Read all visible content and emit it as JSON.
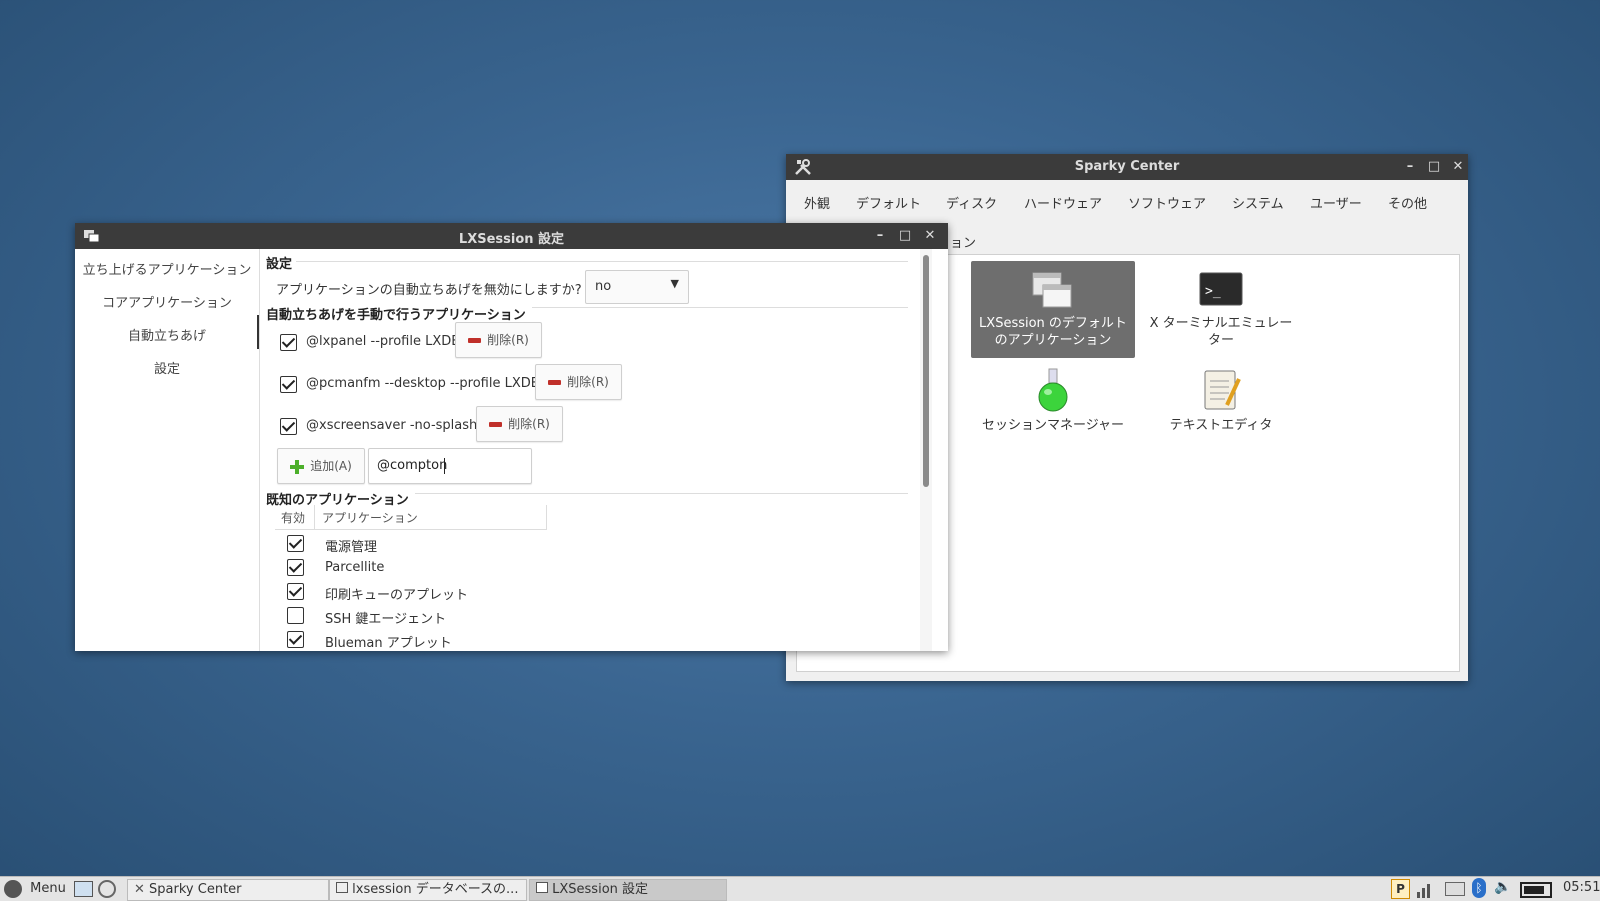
{
  "sparky": {
    "title": "Sparky Center",
    "tabs": [
      "外観",
      "デフォルト",
      "ディスク",
      "ハードウェア",
      "ソフトウェア",
      "システム",
      "ユーザー",
      "その他"
    ],
    "partial_text_1": "ョン",
    "partial_text_2": "ー",
    "partial_text_3": "ン",
    "items": [
      {
        "label": "LXSession のデフォルトのアプリケーション",
        "icon": "windows-icon",
        "selected": true
      },
      {
        "label": "X ターミナルエミュレーター",
        "icon": "terminal-icon"
      },
      {
        "label": "セッションマネージャー",
        "icon": "flask-icon"
      },
      {
        "label": "テキストエディタ",
        "icon": "notepad-icon"
      }
    ]
  },
  "lxsession": {
    "title": "LXSession 設定",
    "sidebar": [
      "立ち上げるアプリケーション",
      "コアアプリケーション",
      "自動立ちあげ",
      "設定"
    ],
    "settings_section": "設定",
    "disable_autostart_label": "アプリケーションの自動立ちあげを無効にしますか?",
    "disable_autostart_value": "no",
    "manual_section": "自動立ちあげを手動で行うアプリケーション",
    "manual_apps": [
      {
        "cmd": "@lxpanel --profile LXDE",
        "checked": true
      },
      {
        "cmd": "@pcmanfm --desktop --profile LXDE",
        "checked": true
      },
      {
        "cmd": "@xscreensaver -no-splash",
        "checked": true
      }
    ],
    "remove_label": "削除(R)",
    "add_label": "追加(A)",
    "add_input_value": "@compton",
    "known_section": "既知のアプリケーション",
    "col_enabled": "有効",
    "col_app": "アプリケーション",
    "known_apps": [
      {
        "name": "電源管理",
        "checked": true
      },
      {
        "name": "Parcellite",
        "checked": true
      },
      {
        "name": "印刷キューのアプレット",
        "checked": true
      },
      {
        "name": "SSH 鍵エージェント",
        "checked": false
      },
      {
        "name": "Blueman アプレット",
        "checked": true
      }
    ]
  },
  "taskbar": {
    "menu_label": "Menu",
    "tasks": [
      "Sparky Center",
      "lxsession データベースの...",
      "LXSession 設定"
    ],
    "clock": "05:51",
    "tray_p": "P"
  }
}
